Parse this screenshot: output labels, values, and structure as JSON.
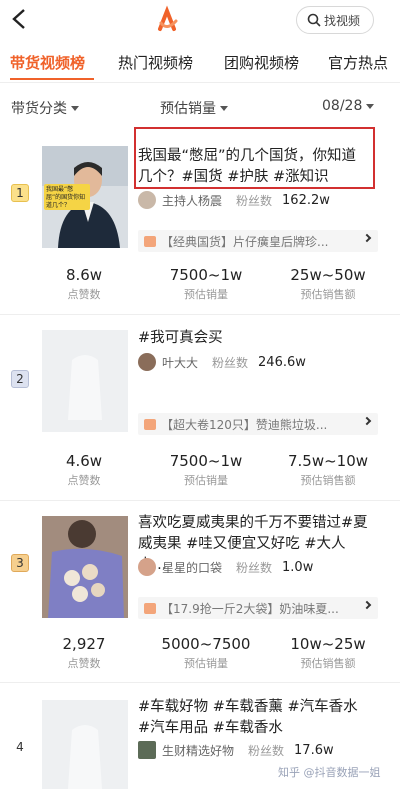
{
  "header": {
    "search_label": "找视频"
  },
  "tabs": [
    {
      "label": "带货视频榜",
      "active": true
    },
    {
      "label": "热门视频榜",
      "active": false
    },
    {
      "label": "团购视频榜",
      "active": false
    },
    {
      "label": "官方热点",
      "active": false
    }
  ],
  "filters": {
    "category": "带货分类",
    "sort": "预估销量",
    "date": "08/28"
  },
  "items": [
    {
      "rank": "1",
      "title": "我国最“憋屈”的几个国货，你知道几个？#国货 #护肤 #涨知识",
      "author": "主持人杨震",
      "fans_label": "粉丝数",
      "fans": "162.2w",
      "product": "【经典国货】片仔癀皇后牌珍...",
      "thumb_text": "我国最“憋屈”的国货你知道几个？",
      "stats": [
        {
          "value": "8.6w",
          "label": "点赞数"
        },
        {
          "value": "7500~1w",
          "label": "预估销量"
        },
        {
          "value": "25w~50w",
          "label": "预估销售额"
        }
      ]
    },
    {
      "rank": "2",
      "title": "#我可真会买",
      "author": "叶大大",
      "fans_label": "粉丝数",
      "fans": "246.6w",
      "product": "【超大卷120只】赞迪熊垃圾...",
      "stats": [
        {
          "value": "4.6w",
          "label": "点赞数"
        },
        {
          "value": "7500~1w",
          "label": "预估销量"
        },
        {
          "value": "7.5w~10w",
          "label": "预估销售额"
        }
      ]
    },
    {
      "rank": "3",
      "title": "喜欢吃夏威夷果的千万不要错过#夏威夷果 #哇又便宜又好吃 #大人小...",
      "author": "星星的口袋",
      "fans_label": "粉丝数",
      "fans": "1.0w",
      "product": "【17.9抢一斤2大袋】奶油味夏...",
      "stats": [
        {
          "value": "2,927",
          "label": "点赞数"
        },
        {
          "value": "5000~7500",
          "label": "预估销量"
        },
        {
          "value": "10w~25w",
          "label": "预估销售额"
        }
      ]
    },
    {
      "rank": "4",
      "title": "#车载好物 #车载香薰 #汽车香水 #汽车用品 #车载香水",
      "author": "生财精选好物",
      "fans_label": "粉丝数",
      "fans": "17.6w"
    }
  ],
  "watermark": "知乎 @抖音数据一姐",
  "colors": {
    "accent": "#f0622a",
    "highlight_box": "#d23030"
  }
}
